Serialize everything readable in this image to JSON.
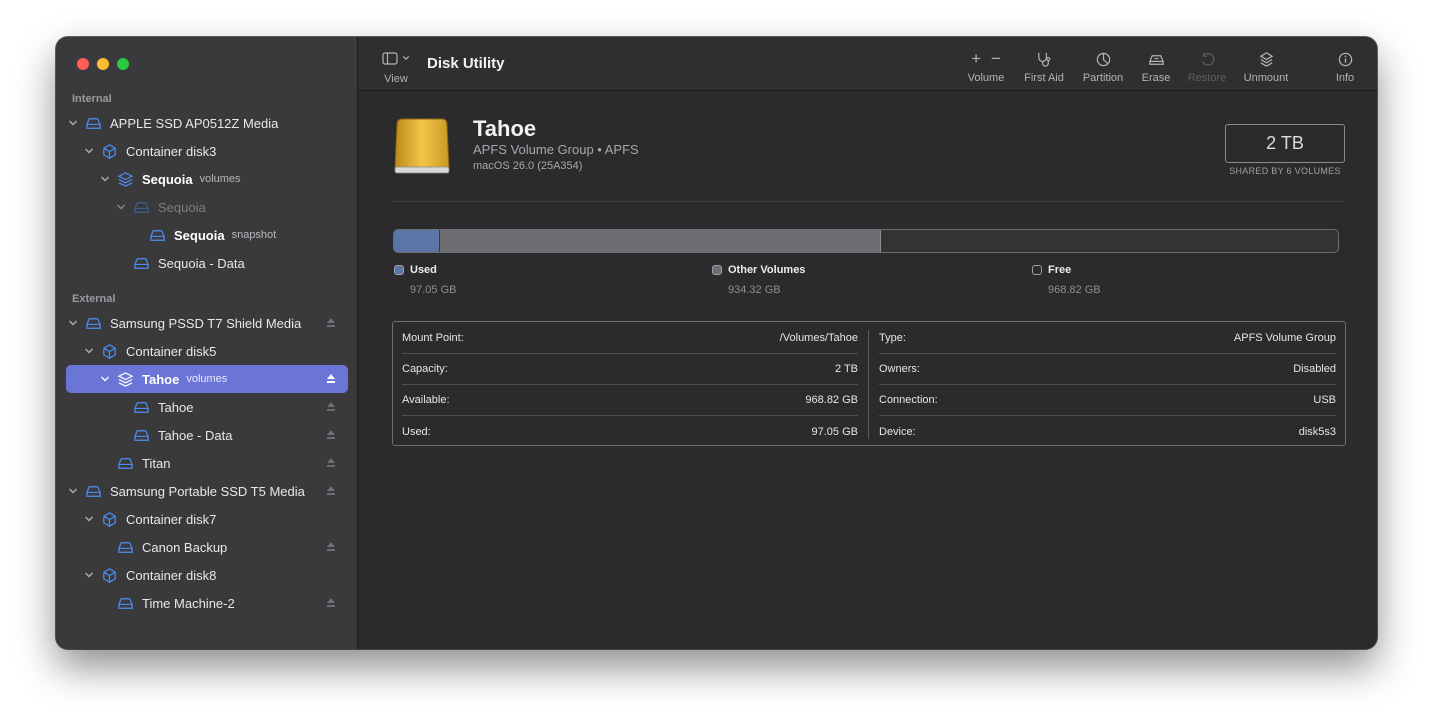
{
  "app": {
    "title": "Disk Utility"
  },
  "sidebar": {
    "sections": {
      "internal": "Internal",
      "external": "External"
    },
    "items": [
      {
        "label": "APPLE SSD AP0512Z Media",
        "suffix": ""
      },
      {
        "label": "Container disk3",
        "suffix": ""
      },
      {
        "label": "Sequoia",
        "suffix": "volumes"
      },
      {
        "label": "Sequoia",
        "suffix": ""
      },
      {
        "label": "Sequoia",
        "suffix": "snapshot"
      },
      {
        "label": "Sequoia - Data",
        "suffix": ""
      },
      {
        "label": "Samsung PSSD T7 Shield Media",
        "suffix": ""
      },
      {
        "label": "Container disk5",
        "suffix": ""
      },
      {
        "label": "Tahoe",
        "suffix": "volumes"
      },
      {
        "label": "Tahoe",
        "suffix": ""
      },
      {
        "label": "Tahoe - Data",
        "suffix": ""
      },
      {
        "label": "Titan",
        "suffix": ""
      },
      {
        "label": "Samsung Portable SSD T5 Media",
        "suffix": ""
      },
      {
        "label": "Container disk7",
        "suffix": ""
      },
      {
        "label": "Canon Backup",
        "suffix": ""
      },
      {
        "label": "Container disk8",
        "suffix": ""
      },
      {
        "label": "Time Machine-2",
        "suffix": ""
      }
    ]
  },
  "toolbar": {
    "view": "View",
    "volume": "Volume",
    "volume_add": "+",
    "volume_remove": "−",
    "first_aid": "First Aid",
    "partition": "Partition",
    "erase": "Erase",
    "restore": "Restore",
    "unmount": "Unmount",
    "info": "Info"
  },
  "volume": {
    "name": "Tahoe",
    "subtitle": "APFS Volume Group • APFS",
    "os": "macOS 26.0 (25A354)",
    "capacity": "2 TB",
    "capacity_note": "SHARED BY 6 VOLUMES"
  },
  "usage": {
    "used_fraction": 0.0485,
    "other_fraction": 0.467,
    "legend": [
      {
        "label": "Used",
        "value": "97.05 GB",
        "color": "#5b75a6"
      },
      {
        "label": "Other Volumes",
        "value": "934.32 GB",
        "color": "#6e6e72"
      },
      {
        "label": "Free",
        "value": "968.82 GB",
        "color": "#2b2b2d"
      }
    ]
  },
  "details": {
    "left": [
      {
        "key": "Mount Point:",
        "value": "/Volumes/Tahoe"
      },
      {
        "key": "Capacity:",
        "value": "2 TB"
      },
      {
        "key": "Available:",
        "value": "968.82 GB"
      },
      {
        "key": "Used:",
        "value": "97.05 GB"
      }
    ],
    "right": [
      {
        "key": "Type:",
        "value": "APFS Volume Group"
      },
      {
        "key": "Owners:",
        "value": "Disabled"
      },
      {
        "key": "Connection:",
        "value": "USB"
      },
      {
        "key": "Device:",
        "value": "disk5s3"
      }
    ]
  },
  "colors": {
    "accent": "#6a75d6",
    "icon_blue": "#4a8ef5"
  }
}
